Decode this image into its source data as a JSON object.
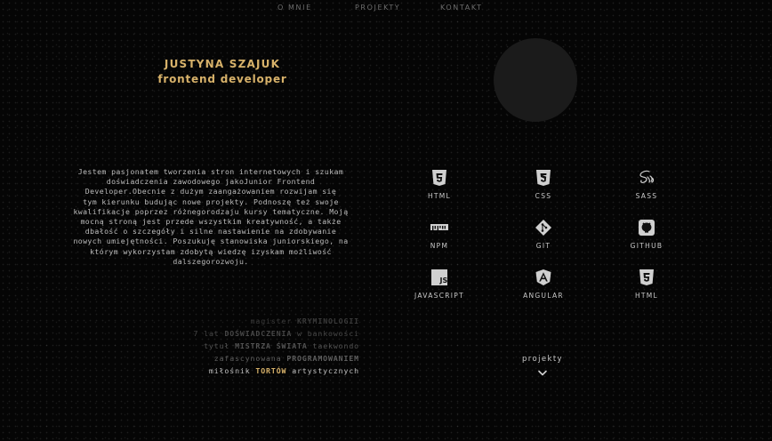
{
  "nav": {
    "items": [
      "O MNIE",
      "PROJEKTY",
      "KONTAKT"
    ]
  },
  "hero": {
    "name": "JUSTYNA SZAJUK",
    "role": "frontend developer"
  },
  "about": {
    "bio_lines": [
      "Jestem pasjonatem tworzenia stron internetowych i szukam",
      "doświadczenia zawodowego jakoJunior Frontend",
      "Developer.Obecnie z dużym zaangażowaniem rozwijam się",
      "tym kierunku budując nowe projekty. Podnoszę też swoje",
      "kwalifikacje poprzez różnegorodzaju kursy tematyczne. Moją",
      "mocną stroną jest przede wszystkim kreatywność, a także",
      "dbałość o szczegóły i silne nastawienie na zdobywanie",
      "nowych umiejętności. Poszukuję stanowiska juniorskiego, na",
      "którym wykorzystam zdobytą wiedzę izyskam możliwość",
      "dalszegorozwoju."
    ]
  },
  "facts": [
    {
      "pre": "magister ",
      "strong": "KRYMINOLOGII",
      "post": ""
    },
    {
      "pre": "7 lat ",
      "strong": "DOŚWIADCZENIA",
      "post": " w bankowości"
    },
    {
      "pre": "tytuł ",
      "strong": "MISTRZA ŚWIATA",
      "post": " taekwondo"
    },
    {
      "pre": "zafascynowana ",
      "strong": "PROGRAMOWANIEM",
      "post": ""
    },
    {
      "pre": "miłośnik ",
      "strong": "TORTÓW",
      "post": " artystycznych"
    }
  ],
  "skills": [
    {
      "label": "HTML",
      "icon": "html5-icon"
    },
    {
      "label": "CSS",
      "icon": "css3-icon"
    },
    {
      "label": "SASS",
      "icon": "sass-icon"
    },
    {
      "label": "NPM",
      "icon": "npm-icon"
    },
    {
      "label": "GIT",
      "icon": "git-icon"
    },
    {
      "label": "GITHUB",
      "icon": "github-icon"
    },
    {
      "label": "JAVASCRIPT",
      "icon": "javascript-icon"
    },
    {
      "label": "ANGULAR",
      "icon": "angular-icon"
    },
    {
      "label": "HTML",
      "icon": "html5-icon"
    }
  ],
  "projects_link": {
    "label": "projekty",
    "icon": "chevron-down-icon"
  },
  "colors": {
    "background": "#050505",
    "accent": "#d8b26a",
    "text": "#bdbdbd",
    "nav": "#6e6e6e",
    "avatar": "#1b1b1b"
  }
}
